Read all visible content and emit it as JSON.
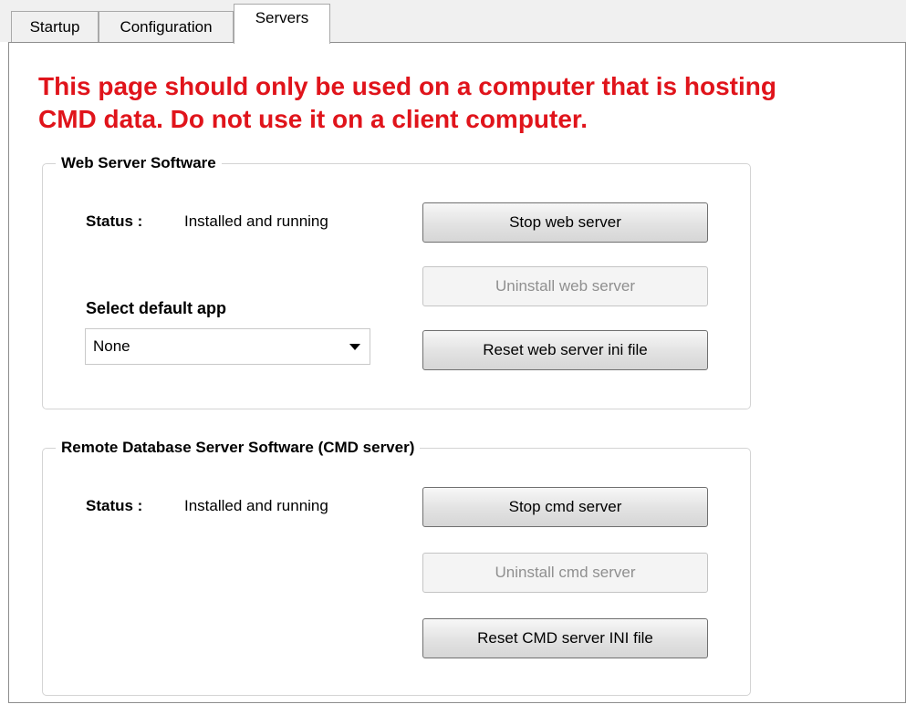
{
  "tabs": [
    {
      "label": "Startup",
      "active": false
    },
    {
      "label": "Configuration",
      "active": false
    },
    {
      "label": "Servers",
      "active": true
    }
  ],
  "warning": {
    "text": "This page should only be used on a computer that is hosting\nCMD data. Do not use it on a client computer.",
    "color": "#e0141b"
  },
  "web_server": {
    "title": "Web Server Software",
    "status_label": "Status :",
    "status_value": "Installed and running",
    "stop_button": "Stop web server",
    "uninstall_button": "Uninstall web server",
    "select_label": "Select default app",
    "select_value": "None",
    "reset_button": "Reset web server ini file"
  },
  "cmd_server": {
    "title": "Remote Database Server Software (CMD server)",
    "status_label": "Status :",
    "status_value": "Installed and running",
    "stop_button": "Stop cmd server",
    "uninstall_button": "Uninstall cmd server",
    "reset_button": "Reset CMD server INI file"
  }
}
